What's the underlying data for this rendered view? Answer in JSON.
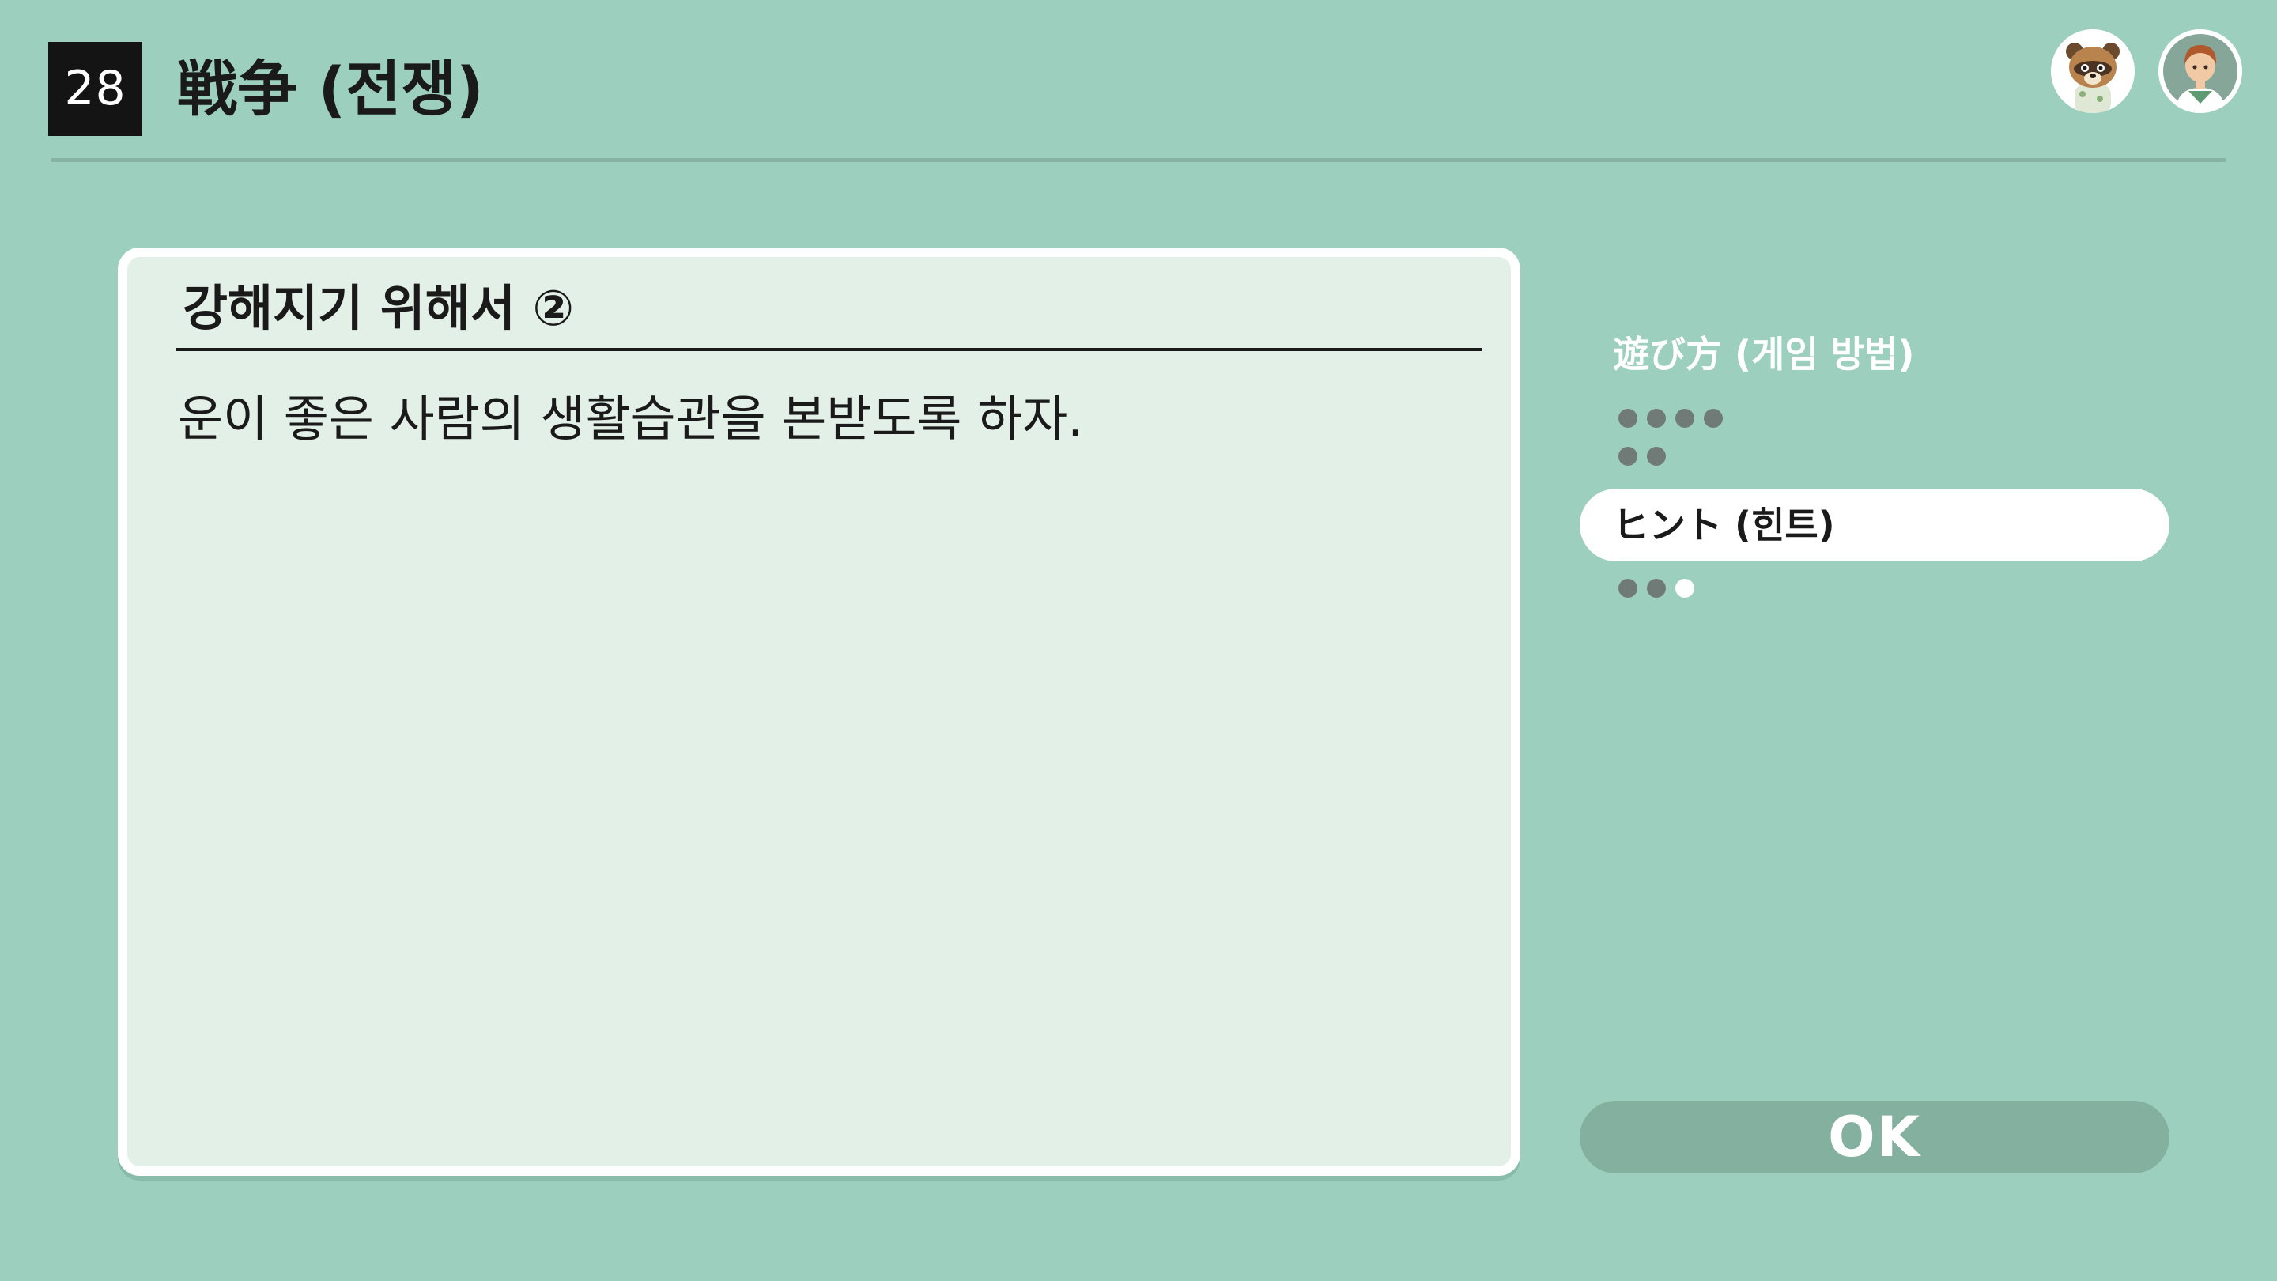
{
  "header": {
    "level_number": "28",
    "level_title": "戦争 (전쟁)"
  },
  "avatars": [
    {
      "icon": "raccoon-character-icon"
    },
    {
      "icon": "player-character-icon"
    }
  ],
  "card": {
    "title": "강해지기 위해서 ②",
    "body": "운이 좋은 사람의 생활습관을 본받도록 하자."
  },
  "side_menu": {
    "rules_label": "遊び方 (게임 방법)",
    "rules_pages": 6,
    "rules_current_page": 0,
    "hint_label": "ヒント (힌트)",
    "hint_pages": 3,
    "hint_current_page": 3
  },
  "ok_button": {
    "label": "OK"
  },
  "colors": {
    "background": "#9dcfbe",
    "card": "#e3f0e7",
    "ok_button": "#83b09f",
    "dot_inactive": "#707a76",
    "dot_active": "#ffffff"
  }
}
